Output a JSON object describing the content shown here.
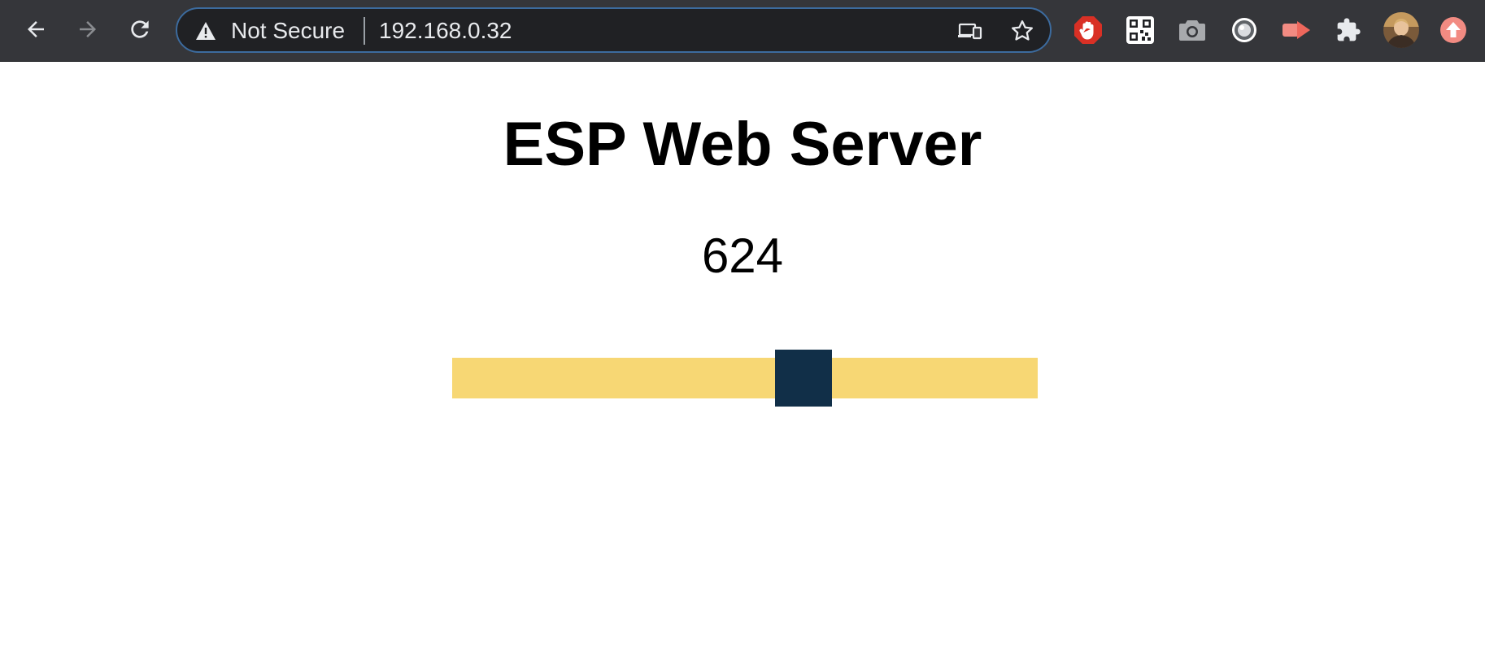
{
  "browser": {
    "security_label": "Not Secure",
    "url": "192.168.0.32",
    "nav_icons": [
      "back-arrow-icon",
      "forward-arrow-icon",
      "reload-icon"
    ],
    "extension_icons": [
      "adblock-hand-icon",
      "qr-code-icon",
      "camera-icon",
      "lens-icon",
      "video-arrow-icon",
      "puzzle-extensions-icon",
      "profile-avatar",
      "update-arrow-icon"
    ]
  },
  "page": {
    "title": "ESP Web Server",
    "slider": {
      "value": "624",
      "min": 0,
      "max": 1023,
      "fraction": 0.61,
      "track_color": "#f7d774",
      "thumb_color": "#112f48"
    }
  }
}
